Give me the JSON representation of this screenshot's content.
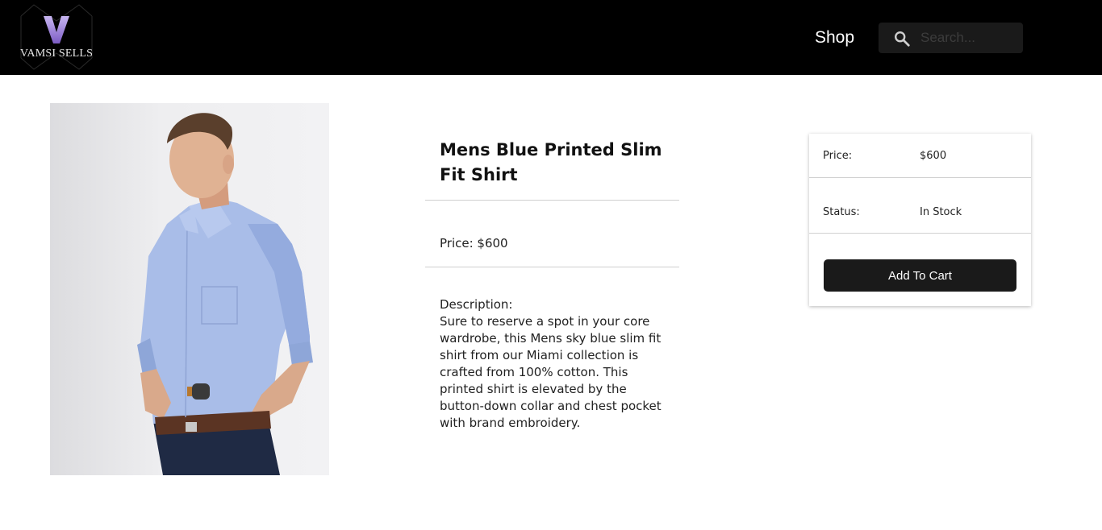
{
  "header": {
    "logo_letter": "V",
    "logo_text": "VAMSI SELLS",
    "nav_shop": "Shop",
    "search_placeholder": "Search..."
  },
  "product": {
    "title": "Mens Blue Printed Slim Fit Shirt",
    "price_line": "Price: $600",
    "description_label": "Description:",
    "description": "Sure to reserve a spot in your core wardrobe, this Mens sky blue slim fit shirt from our Miami collection is crafted from 100% cotton. This printed shirt is elevated by the button-down collar and chest pocket with brand embroidery."
  },
  "cart": {
    "price_label": "Price:",
    "price_value": "$600",
    "status_label": "Status:",
    "status_value": "In Stock",
    "button_label": "Add To Cart"
  },
  "colors": {
    "header_bg": "#000000",
    "button_bg": "#1a1a1a",
    "logo_accent": "#9b7fd6"
  }
}
